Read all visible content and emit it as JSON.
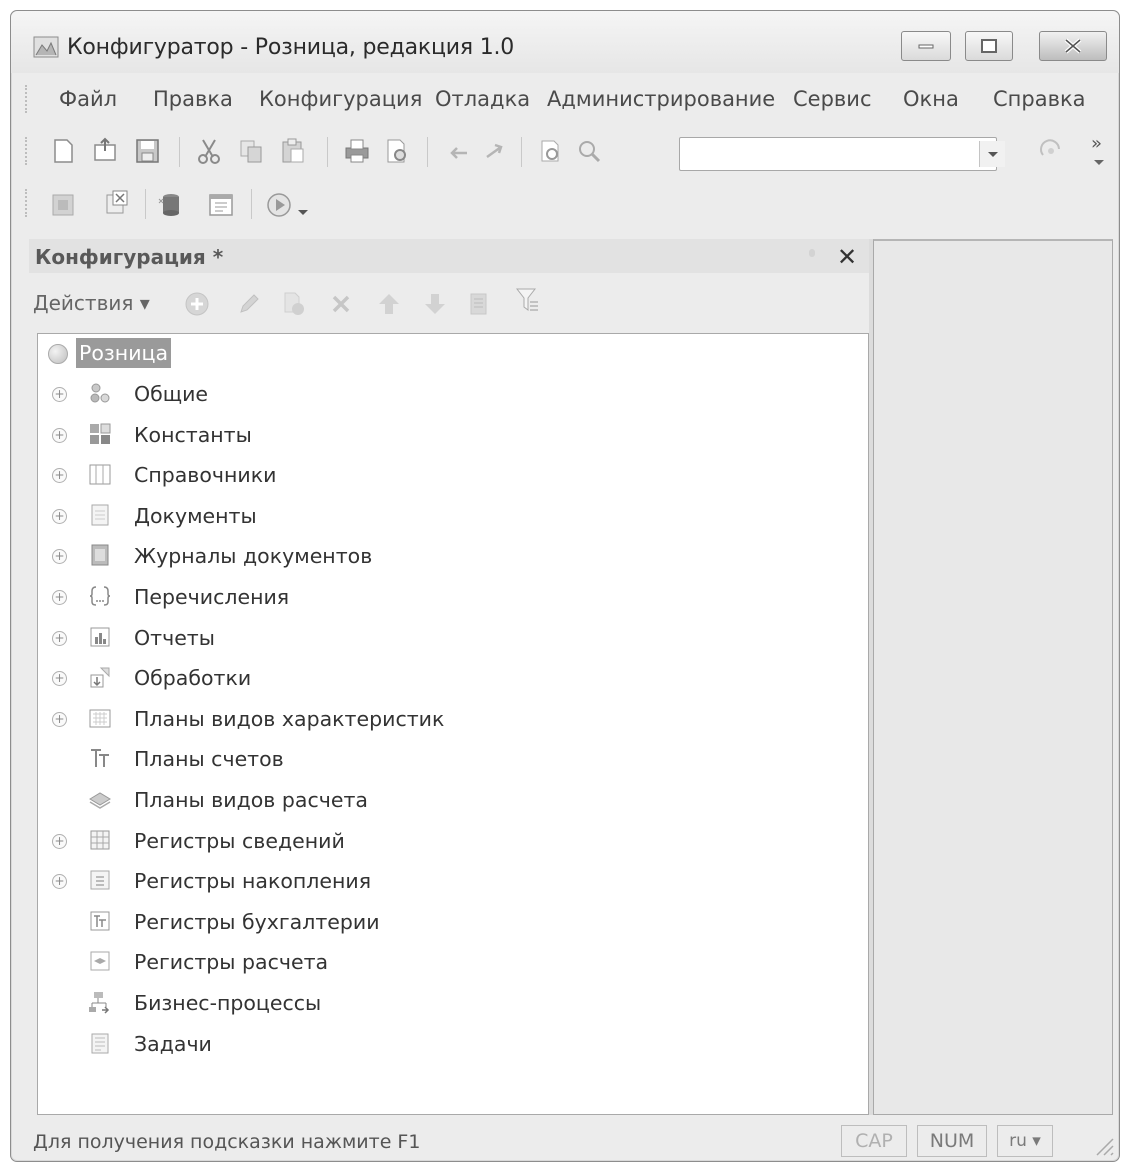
{
  "window": {
    "title": "Конфигуратор - Розница, редакция 1.0"
  },
  "menu": {
    "items": [
      "Файл",
      "Правка",
      "Конфигурация",
      "Отладка",
      "Администрирование",
      "Сервис",
      "Окна",
      "Справка"
    ]
  },
  "toolbar": {
    "search_value": "",
    "overflow_glyph": "»"
  },
  "panel": {
    "title": "Конфигурация *",
    "actions_label": "Действия ▾",
    "close_glyph": "✕"
  },
  "tree": {
    "root": "Розница",
    "items": [
      {
        "label": "Общие",
        "expandable": true,
        "icon": "common-icon"
      },
      {
        "label": "Константы",
        "expandable": true,
        "icon": "constants-icon"
      },
      {
        "label": "Справочники",
        "expandable": true,
        "icon": "catalogs-icon"
      },
      {
        "label": "Документы",
        "expandable": true,
        "icon": "documents-icon"
      },
      {
        "label": "Журналы документов",
        "expandable": true,
        "icon": "journals-icon"
      },
      {
        "label": "Перечисления",
        "expandable": true,
        "icon": "enums-icon"
      },
      {
        "label": "Отчеты",
        "expandable": true,
        "icon": "reports-icon"
      },
      {
        "label": "Обработки",
        "expandable": true,
        "icon": "processing-icon"
      },
      {
        "label": "Планы видов характеристик",
        "expandable": true,
        "icon": "char-types-icon"
      },
      {
        "label": "Планы счетов",
        "expandable": false,
        "icon": "accounts-icon"
      },
      {
        "label": "Планы видов расчета",
        "expandable": false,
        "icon": "calc-types-icon"
      },
      {
        "label": "Регистры сведений",
        "expandable": true,
        "icon": "info-registers-icon"
      },
      {
        "label": "Регистры накопления",
        "expandable": true,
        "icon": "accum-registers-icon"
      },
      {
        "label": "Регистры бухгалтерии",
        "expandable": false,
        "icon": "accounting-registers-icon"
      },
      {
        "label": "Регистры расчета",
        "expandable": false,
        "icon": "calc-registers-icon"
      },
      {
        "label": "Бизнес-процессы",
        "expandable": false,
        "icon": "business-process-icon"
      },
      {
        "label": "Задачи",
        "expandable": false,
        "icon": "tasks-icon"
      }
    ],
    "expander_glyph": "+"
  },
  "status": {
    "hint": "Для получения подсказки нажмите F1",
    "cap": "CAP",
    "num": "NUM",
    "lang": "ru ▾"
  },
  "colors": {
    "window_bg": "#ececec",
    "selection": "#9a9a9a"
  }
}
